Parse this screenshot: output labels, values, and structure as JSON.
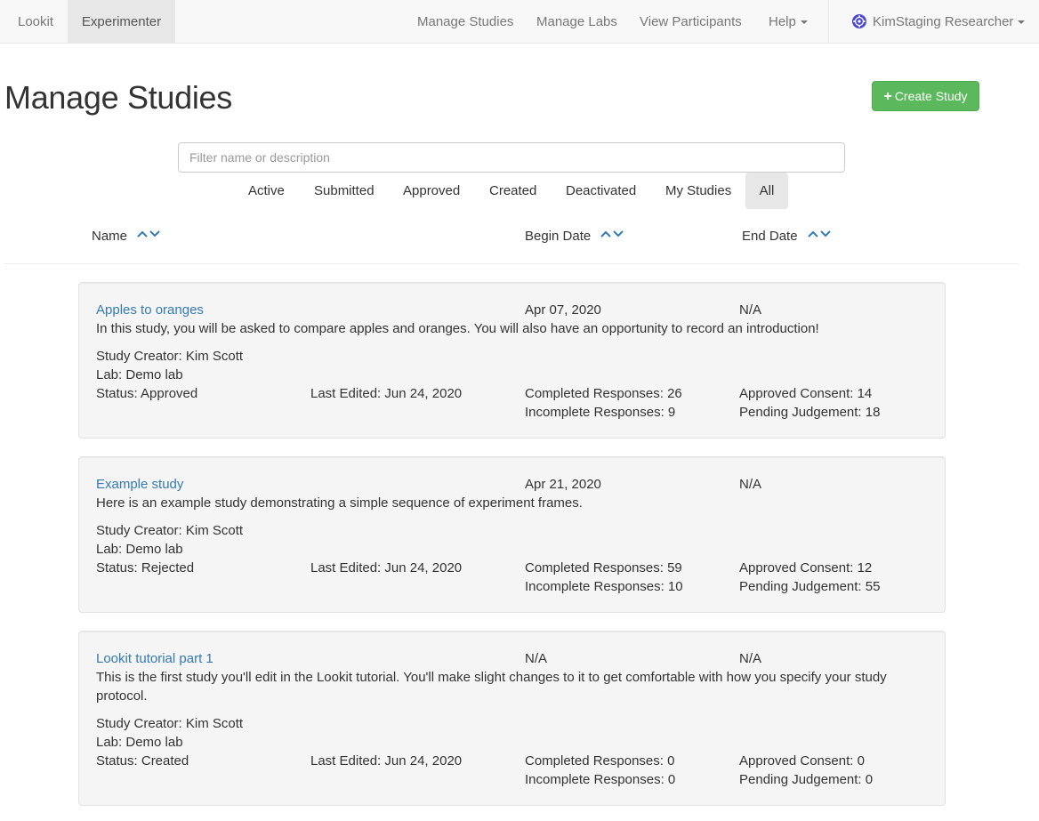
{
  "navbar": {
    "brand": "Lookit",
    "experimenter": "Experimenter",
    "links": [
      "Manage Studies",
      "Manage Labs",
      "View Participants",
      "Help"
    ],
    "user": "KimStaging Researcher"
  },
  "page": {
    "title": "Manage Studies",
    "create_button": "Create Study"
  },
  "filter": {
    "placeholder": "Filter name or description",
    "value": ""
  },
  "tabs": [
    "Active",
    "Submitted",
    "Approved",
    "Created",
    "Deactivated",
    "My Studies",
    "All"
  ],
  "active_tab": "All",
  "columns": [
    "Name",
    "Begin Date",
    "End Date"
  ],
  "studies": [
    {
      "name": "Apples to oranges",
      "begin": "Apr 07, 2020",
      "end": "N/A",
      "description": "In this study, you will be asked to compare apples and oranges. You will also have an opportunity to record an introduction!",
      "creator": "Study Creator: Kim Scott",
      "lab": "Lab: Demo lab",
      "status": "Status: Approved",
      "edited": "Last Edited: Jun 24, 2020",
      "completed": "Completed Responses: 26",
      "incomplete": "Incomplete Responses: 9",
      "consent": "Approved Consent: 14",
      "pending": "Pending Judgement: 18"
    },
    {
      "name": "Example study",
      "begin": "Apr 21, 2020",
      "end": "N/A",
      "description": "Here is an example study demonstrating a simple sequence of experiment frames.",
      "creator": "Study Creator: Kim Scott",
      "lab": "Lab: Demo lab",
      "status": "Status: Rejected",
      "edited": "Last Edited: Jun 24, 2020",
      "completed": "Completed Responses: 59",
      "incomplete": "Incomplete Responses: 10",
      "consent": "Approved Consent: 12",
      "pending": "Pending Judgement: 55"
    },
    {
      "name": "Lookit tutorial part 1",
      "begin": "N/A",
      "end": "N/A",
      "description": "This is the first study you'll edit in the Lookit tutorial. You'll make slight changes to it to get comfortable with how you specify your study protocol.",
      "creator": "Study Creator: Kim Scott",
      "lab": "Lab: Demo lab",
      "status": "Status: Created",
      "edited": "Last Edited: Jun 24, 2020",
      "completed": "Completed Responses: 0",
      "incomplete": "Incomplete Responses: 0",
      "consent": "Approved Consent: 0",
      "pending": "Pending Judgement: 0"
    }
  ],
  "colors": {
    "link": "#337ab7",
    "success": "#5cb85c",
    "card_bg": "#f5f5f5",
    "navbar_bg": "#f8f8f8"
  }
}
